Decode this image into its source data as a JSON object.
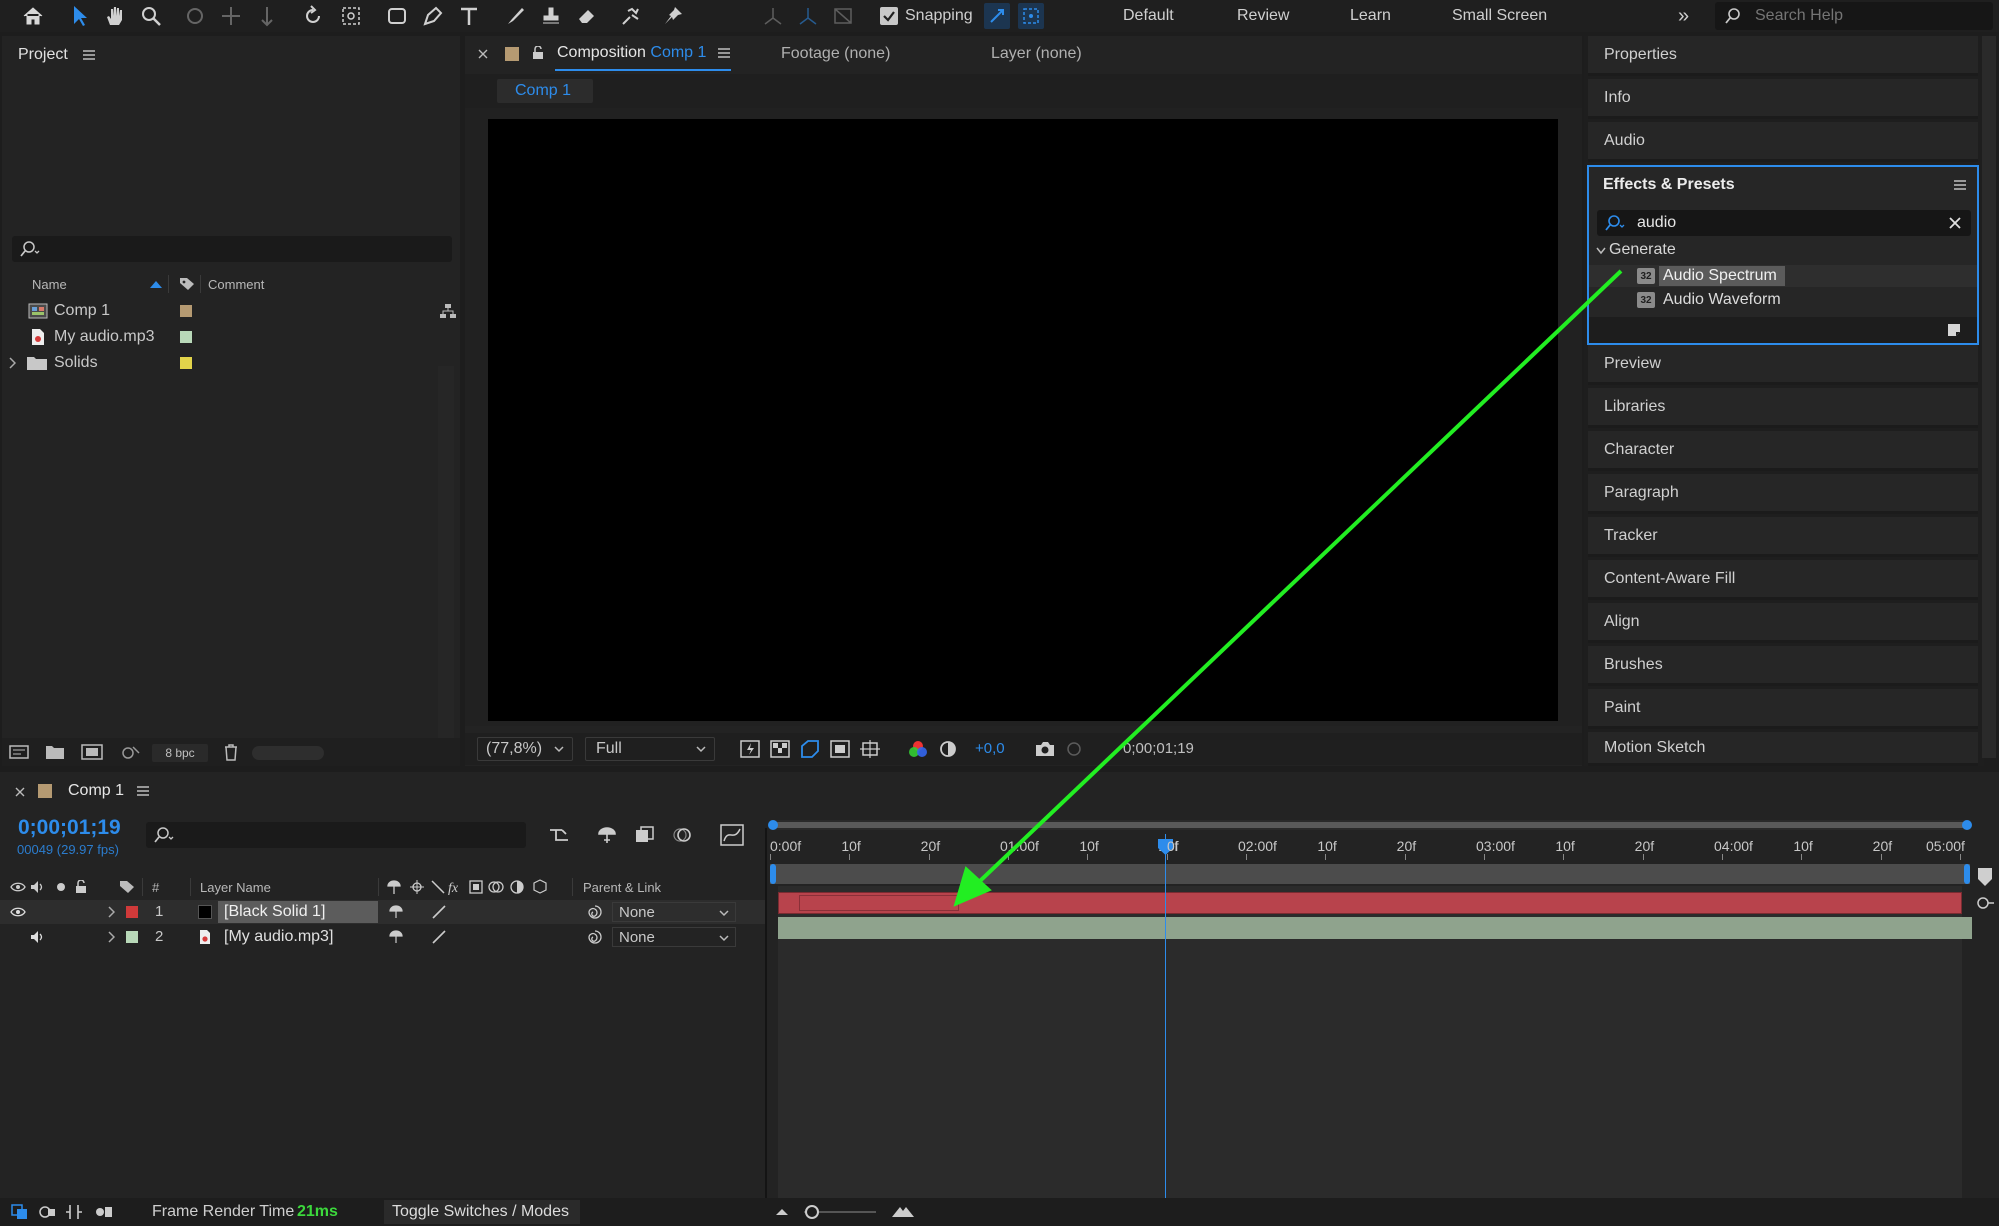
{
  "toolbar": {
    "snapping_label": "Snapping",
    "workspaces": [
      "Default",
      "Review",
      "Learn",
      "Small Screen"
    ],
    "more_label": "»",
    "search_placeholder": "Search Help"
  },
  "project": {
    "title": "Project",
    "search_value": "",
    "col_name": "Name",
    "col_comment": "Comment",
    "items": [
      {
        "name": "Comp 1",
        "color": "#b59a72"
      },
      {
        "name": "My audio.mp3",
        "color": "#b8d8b8"
      },
      {
        "name": "Solids",
        "color": "#e2d44a"
      }
    ],
    "bpc_label": "8 bpc"
  },
  "viewer": {
    "tab_prefix": "Composition",
    "tab_comp": "Comp 1",
    "footage_tab": "Footage (none)",
    "layer_tab": "Layer (none)",
    "subtab": "Comp 1",
    "zoom": "(77,8%)",
    "resolution": "Full",
    "exposure": "+0,0",
    "timecode": "0;00;01;19"
  },
  "right_panels": {
    "top": [
      "Properties",
      "Info",
      "Audio"
    ],
    "effects": {
      "title": "Effects & Presets",
      "search_value": "audio",
      "group": "Generate",
      "items": [
        "Audio Spectrum",
        "Audio Waveform"
      ],
      "badge": "32"
    },
    "bottom": [
      "Preview",
      "Libraries",
      "Character",
      "Paragraph",
      "Tracker",
      "Content-Aware Fill",
      "Align",
      "Brushes",
      "Paint",
      "Motion Sketch"
    ]
  },
  "timeline": {
    "comp_title": "Comp 1",
    "timecode": "0;00;01;19",
    "frame_info": "00049 (29.97 fps)",
    "col_hash": "#",
    "col_layer_name": "Layer Name",
    "col_parent": "Parent & Link",
    "layers": [
      {
        "num": "1",
        "name": "[Black Solid 1]",
        "parent": "None",
        "label_color": "#d03a3a"
      },
      {
        "num": "2",
        "name": "[My audio.mp3]",
        "parent": "None",
        "label_color": "#b8d8b8"
      }
    ],
    "ruler": [
      "0:00f",
      "10f",
      "20f",
      "01:00f",
      "10f",
      "20f",
      "02:00f",
      "10f",
      "20f",
      "03:00f",
      "10f",
      "20f",
      "04:00f",
      "10f",
      "20f",
      "05:00f"
    ],
    "playhead_label": "0f"
  },
  "status": {
    "render_label": "Frame Render Time",
    "render_value": "21ms",
    "toggle_label": "Toggle Switches / Modes"
  },
  "colors": {
    "accent": "#2d8ceb",
    "annotation_arrow": "#22ee22",
    "layer1_bar": "#b8434c",
    "layer2_bar": "#8fa38d"
  }
}
